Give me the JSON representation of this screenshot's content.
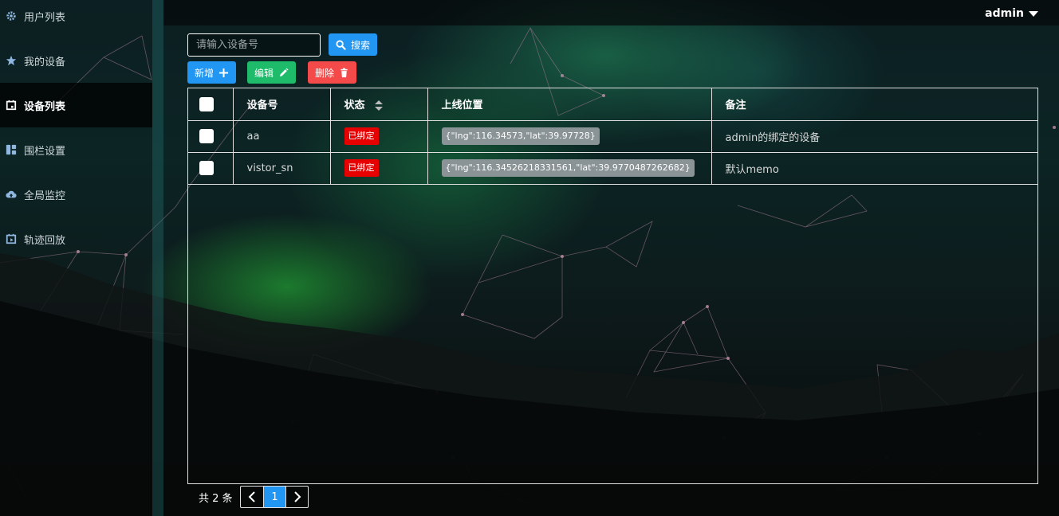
{
  "header": {
    "username": "admin"
  },
  "sidebar": {
    "items": [
      {
        "label": "用户列表",
        "icon": "gear-icon",
        "active": false
      },
      {
        "label": "我的设备",
        "icon": "star-icon",
        "active": false
      },
      {
        "label": "设备列表",
        "icon": "calendar-icon",
        "active": true
      },
      {
        "label": "围栏设置",
        "icon": "grid-icon",
        "active": false
      },
      {
        "label": "全局监控",
        "icon": "cloud-upload-icon",
        "active": false
      },
      {
        "label": "轨迹回放",
        "icon": "calendar-play-icon",
        "active": false
      }
    ]
  },
  "toolbar": {
    "search_placeholder": "请输入设备号",
    "search_label": "搜索",
    "add_label": "新增",
    "edit_label": "编辑",
    "delete_label": "删除"
  },
  "table": {
    "headers": {
      "sn": "设备号",
      "status": "状态",
      "location": "上线位置",
      "memo": "备注"
    },
    "rows": [
      {
        "sn": "aa",
        "status": "已绑定",
        "location": "{\"lng\":116.34573,\"lat\":39.97728}",
        "memo": "admin的绑定的设备"
      },
      {
        "sn": "vistor_sn",
        "status": "已绑定",
        "location": "{\"lng\":116.34526218331561,\"lat\":39.9770487262682}",
        "memo": "默认memo"
      }
    ]
  },
  "pagination": {
    "total_text": "共 2 条",
    "current_page": "1"
  },
  "colors": {
    "primary": "#2196f3",
    "success": "#1dbb6a",
    "danger": "#f44a4a",
    "badge_bound": "#e60000",
    "badge_location": "#8a9396"
  }
}
